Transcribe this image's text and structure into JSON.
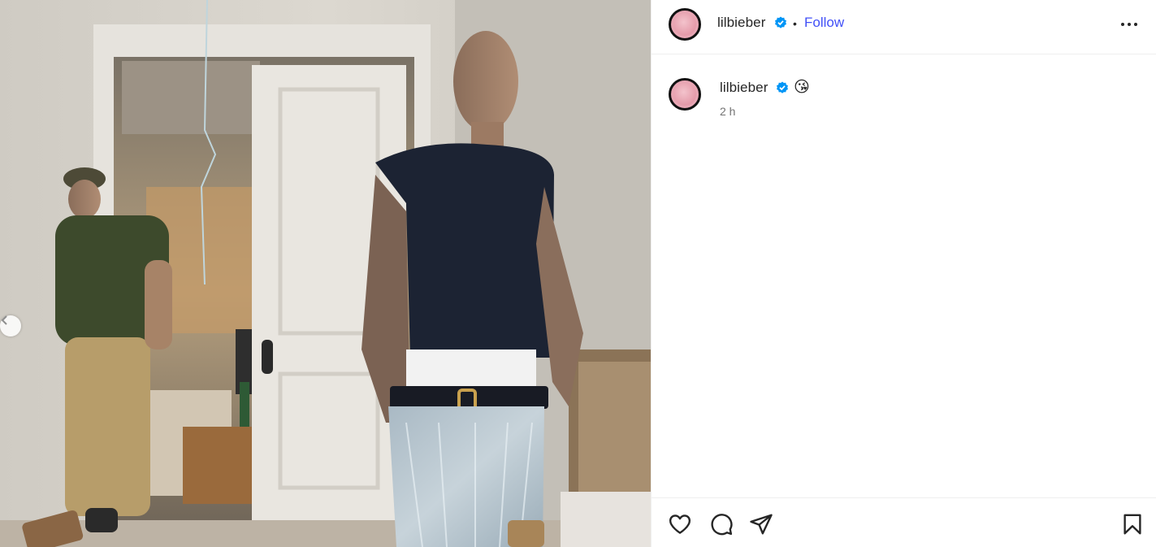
{
  "post": {
    "username": "lilbieber",
    "follow_label": "Follow",
    "separator": "•",
    "caption_emoji": "😘",
    "timestamp": "2 h"
  },
  "icons": {
    "more": "more-options-icon",
    "verified": "verified-badge-icon",
    "like": "heart-icon",
    "comment": "comment-icon",
    "share": "paper-plane-icon",
    "save": "bookmark-icon",
    "prev": "chevron-left-icon"
  },
  "colors": {
    "follow": "#4150f7",
    "verified": "#0095f6",
    "text": "#262626",
    "muted": "#737373"
  }
}
